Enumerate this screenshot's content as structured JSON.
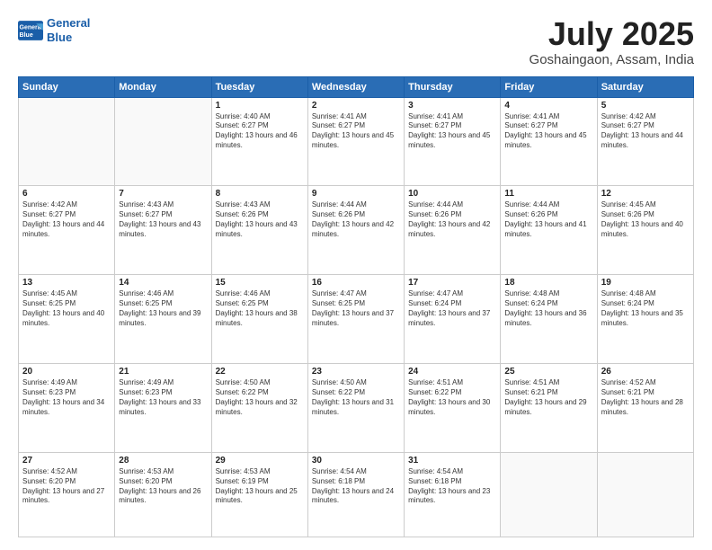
{
  "logo": {
    "line1": "General",
    "line2": "Blue"
  },
  "title": "July 2025",
  "location": "Goshaingaon, Assam, India",
  "weekdays": [
    "Sunday",
    "Monday",
    "Tuesday",
    "Wednesday",
    "Thursday",
    "Friday",
    "Saturday"
  ],
  "weeks": [
    [
      {
        "day": "",
        "info": ""
      },
      {
        "day": "",
        "info": ""
      },
      {
        "day": "1",
        "info": "Sunrise: 4:40 AM\nSunset: 6:27 PM\nDaylight: 13 hours and 46 minutes."
      },
      {
        "day": "2",
        "info": "Sunrise: 4:41 AM\nSunset: 6:27 PM\nDaylight: 13 hours and 45 minutes."
      },
      {
        "day": "3",
        "info": "Sunrise: 4:41 AM\nSunset: 6:27 PM\nDaylight: 13 hours and 45 minutes."
      },
      {
        "day": "4",
        "info": "Sunrise: 4:41 AM\nSunset: 6:27 PM\nDaylight: 13 hours and 45 minutes."
      },
      {
        "day": "5",
        "info": "Sunrise: 4:42 AM\nSunset: 6:27 PM\nDaylight: 13 hours and 44 minutes."
      }
    ],
    [
      {
        "day": "6",
        "info": "Sunrise: 4:42 AM\nSunset: 6:27 PM\nDaylight: 13 hours and 44 minutes."
      },
      {
        "day": "7",
        "info": "Sunrise: 4:43 AM\nSunset: 6:27 PM\nDaylight: 13 hours and 43 minutes."
      },
      {
        "day": "8",
        "info": "Sunrise: 4:43 AM\nSunset: 6:26 PM\nDaylight: 13 hours and 43 minutes."
      },
      {
        "day": "9",
        "info": "Sunrise: 4:44 AM\nSunset: 6:26 PM\nDaylight: 13 hours and 42 minutes."
      },
      {
        "day": "10",
        "info": "Sunrise: 4:44 AM\nSunset: 6:26 PM\nDaylight: 13 hours and 42 minutes."
      },
      {
        "day": "11",
        "info": "Sunrise: 4:44 AM\nSunset: 6:26 PM\nDaylight: 13 hours and 41 minutes."
      },
      {
        "day": "12",
        "info": "Sunrise: 4:45 AM\nSunset: 6:26 PM\nDaylight: 13 hours and 40 minutes."
      }
    ],
    [
      {
        "day": "13",
        "info": "Sunrise: 4:45 AM\nSunset: 6:25 PM\nDaylight: 13 hours and 40 minutes."
      },
      {
        "day": "14",
        "info": "Sunrise: 4:46 AM\nSunset: 6:25 PM\nDaylight: 13 hours and 39 minutes."
      },
      {
        "day": "15",
        "info": "Sunrise: 4:46 AM\nSunset: 6:25 PM\nDaylight: 13 hours and 38 minutes."
      },
      {
        "day": "16",
        "info": "Sunrise: 4:47 AM\nSunset: 6:25 PM\nDaylight: 13 hours and 37 minutes."
      },
      {
        "day": "17",
        "info": "Sunrise: 4:47 AM\nSunset: 6:24 PM\nDaylight: 13 hours and 37 minutes."
      },
      {
        "day": "18",
        "info": "Sunrise: 4:48 AM\nSunset: 6:24 PM\nDaylight: 13 hours and 36 minutes."
      },
      {
        "day": "19",
        "info": "Sunrise: 4:48 AM\nSunset: 6:24 PM\nDaylight: 13 hours and 35 minutes."
      }
    ],
    [
      {
        "day": "20",
        "info": "Sunrise: 4:49 AM\nSunset: 6:23 PM\nDaylight: 13 hours and 34 minutes."
      },
      {
        "day": "21",
        "info": "Sunrise: 4:49 AM\nSunset: 6:23 PM\nDaylight: 13 hours and 33 minutes."
      },
      {
        "day": "22",
        "info": "Sunrise: 4:50 AM\nSunset: 6:22 PM\nDaylight: 13 hours and 32 minutes."
      },
      {
        "day": "23",
        "info": "Sunrise: 4:50 AM\nSunset: 6:22 PM\nDaylight: 13 hours and 31 minutes."
      },
      {
        "day": "24",
        "info": "Sunrise: 4:51 AM\nSunset: 6:22 PM\nDaylight: 13 hours and 30 minutes."
      },
      {
        "day": "25",
        "info": "Sunrise: 4:51 AM\nSunset: 6:21 PM\nDaylight: 13 hours and 29 minutes."
      },
      {
        "day": "26",
        "info": "Sunrise: 4:52 AM\nSunset: 6:21 PM\nDaylight: 13 hours and 28 minutes."
      }
    ],
    [
      {
        "day": "27",
        "info": "Sunrise: 4:52 AM\nSunset: 6:20 PM\nDaylight: 13 hours and 27 minutes."
      },
      {
        "day": "28",
        "info": "Sunrise: 4:53 AM\nSunset: 6:20 PM\nDaylight: 13 hours and 26 minutes."
      },
      {
        "day": "29",
        "info": "Sunrise: 4:53 AM\nSunset: 6:19 PM\nDaylight: 13 hours and 25 minutes."
      },
      {
        "day": "30",
        "info": "Sunrise: 4:54 AM\nSunset: 6:18 PM\nDaylight: 13 hours and 24 minutes."
      },
      {
        "day": "31",
        "info": "Sunrise: 4:54 AM\nSunset: 6:18 PM\nDaylight: 13 hours and 23 minutes."
      },
      {
        "day": "",
        "info": ""
      },
      {
        "day": "",
        "info": ""
      }
    ]
  ]
}
